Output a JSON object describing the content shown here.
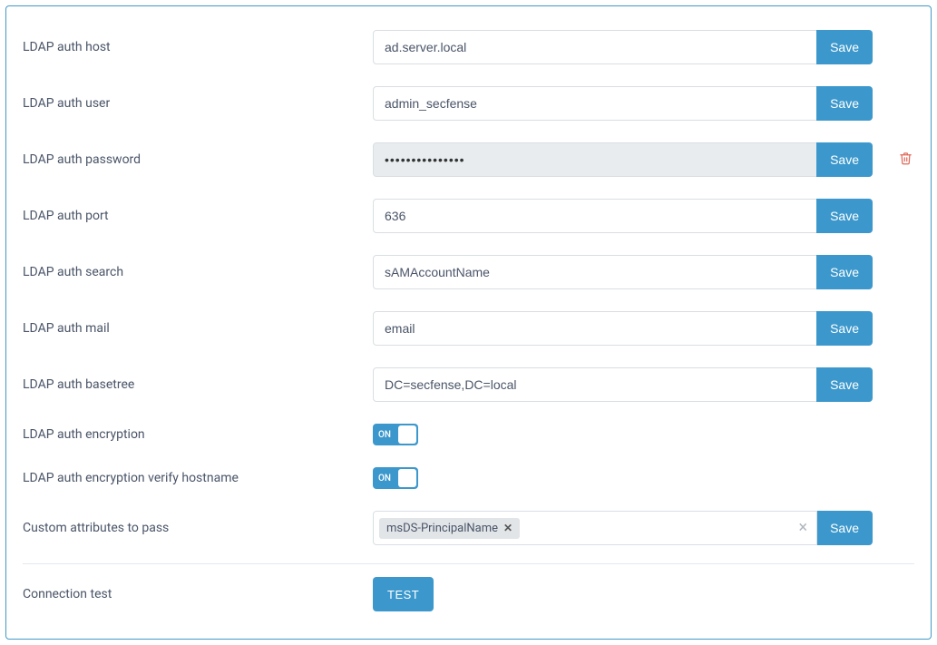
{
  "save_label": "Save",
  "fields": {
    "host": {
      "label": "LDAP auth host",
      "value": "ad.server.local"
    },
    "user": {
      "label": "LDAP auth user",
      "value": "admin_secfense"
    },
    "password": {
      "label": "LDAP auth password",
      "value": "•••••••••••••••"
    },
    "port": {
      "label": "LDAP auth port",
      "value": "636"
    },
    "search": {
      "label": "LDAP auth search",
      "value": "sAMAccountName"
    },
    "mail": {
      "label": "LDAP auth mail",
      "value": "email"
    },
    "basetree": {
      "label": "LDAP auth basetree",
      "value": "DC=secfense,DC=local"
    },
    "encryption": {
      "label": "LDAP auth encryption",
      "toggle": "ON"
    },
    "encryption_verify": {
      "label": "LDAP auth encryption verify hostname",
      "toggle": "ON"
    },
    "custom_attrs": {
      "label": "Custom attributes to pass",
      "tag": "msDS-PrincipalName"
    }
  },
  "connection_test": {
    "label": "Connection test",
    "button": "TEST"
  }
}
